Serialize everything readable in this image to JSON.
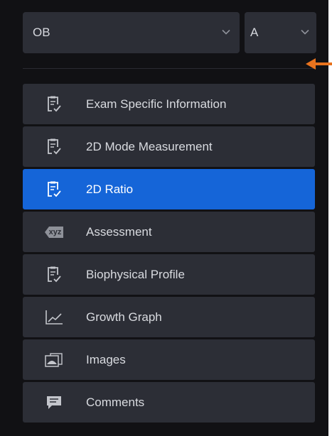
{
  "selectors": {
    "exam_type": "OB",
    "fetus": "A"
  },
  "menu": [
    {
      "label": "Exam Specific Information",
      "icon": "clipboard-check-icon",
      "active": false
    },
    {
      "label": "2D Mode Measurement",
      "icon": "clipboard-check-icon",
      "active": false
    },
    {
      "label": "2D Ratio",
      "icon": "clipboard-check-icon",
      "active": true
    },
    {
      "label": "Assessment",
      "icon": "xyz-tag-icon",
      "icon_text": "xyz",
      "active": false
    },
    {
      "label": "Biophysical Profile",
      "icon": "clipboard-check-icon",
      "active": false
    },
    {
      "label": "Growth Graph",
      "icon": "line-graph-icon",
      "active": false
    },
    {
      "label": "Images",
      "icon": "image-stack-icon",
      "active": false
    },
    {
      "label": "Comments",
      "icon": "comment-icon",
      "active": false
    }
  ],
  "colors": {
    "panel_bg": "#111114",
    "item_bg": "#2c2e36",
    "active_bg": "#1565d8",
    "annotation_arrow": "#e8731e"
  }
}
